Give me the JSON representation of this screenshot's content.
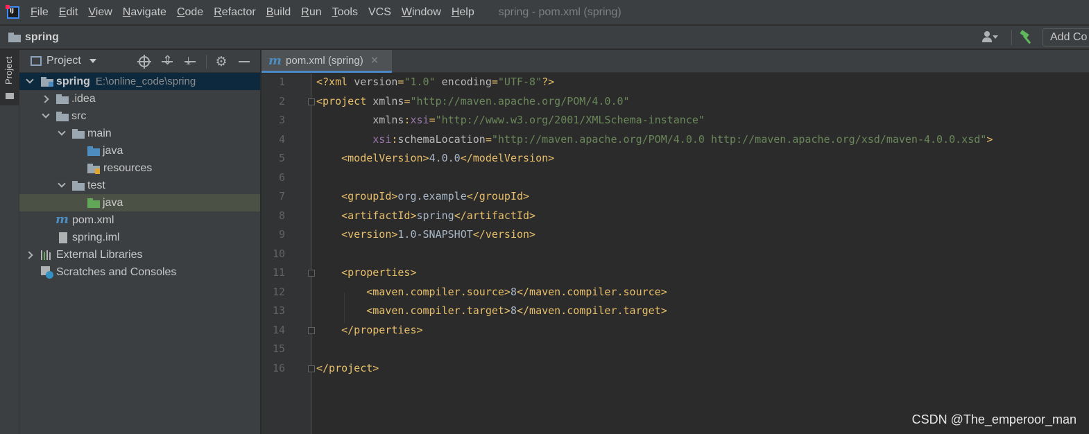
{
  "menubar": {
    "items": [
      {
        "u": "F",
        "rest": "ile"
      },
      {
        "u": "E",
        "rest": "dit"
      },
      {
        "u": "V",
        "rest": "iew"
      },
      {
        "u": "N",
        "rest": "avigate"
      },
      {
        "u": "C",
        "rest": "ode"
      },
      {
        "u": "R",
        "rest": "efactor"
      },
      {
        "u": "B",
        "rest": "uild"
      },
      {
        "u": "R",
        "rest": "un"
      },
      {
        "u": "T",
        "rest": "ools"
      },
      {
        "u": "VCS",
        "rest": ""
      },
      {
        "u": "W",
        "rest": "indow"
      },
      {
        "u": "H",
        "rest": "elp"
      }
    ],
    "window_title": "spring - pom.xml (spring)"
  },
  "navbar": {
    "project": "spring",
    "add_config": "Add Co"
  },
  "tool_strip": {
    "project_tab": "Project"
  },
  "project_panel": {
    "title": "Project",
    "tree": [
      {
        "label": "spring",
        "extra": "E:\\online_code\\spring"
      },
      {
        "label": ".idea"
      },
      {
        "label": "src"
      },
      {
        "label": "main"
      },
      {
        "label": "java"
      },
      {
        "label": "resources"
      },
      {
        "label": "test"
      },
      {
        "label": "java"
      },
      {
        "label": "pom.xml"
      },
      {
        "label": "spring.iml"
      },
      {
        "label": "External Libraries"
      },
      {
        "label": "Scratches and Consoles"
      }
    ]
  },
  "editor": {
    "tab_label": "pom.xml (spring)",
    "line_numbers": [
      "1",
      "2",
      "3",
      "4",
      "5",
      "6",
      "7",
      "8",
      "9",
      "10",
      "11",
      "12",
      "13",
      "14",
      "15",
      "16"
    ],
    "lines": [
      [
        [
          "tag",
          "<?xml "
        ],
        [
          "attr",
          "version"
        ],
        [
          "tag",
          "="
        ],
        [
          "str",
          "\"1.0\""
        ],
        [
          "tag",
          " "
        ],
        [
          "attr",
          "encoding"
        ],
        [
          "tag",
          "="
        ],
        [
          "str",
          "\"UTF-8\""
        ],
        [
          "tag",
          "?>"
        ]
      ],
      [
        [
          "tag",
          "<project "
        ],
        [
          "attr",
          "xmlns"
        ],
        [
          "tag",
          "="
        ],
        [
          "str",
          "\"http://maven.apache.org/POM/4.0.0\""
        ]
      ],
      [
        [
          "text",
          "         "
        ],
        [
          "attr",
          "xmlns"
        ],
        [
          "tag",
          ":"
        ],
        [
          "ns",
          "xsi"
        ],
        [
          "tag",
          "="
        ],
        [
          "str",
          "\"http://www.w3.org/2001/XMLSchema-instance\""
        ]
      ],
      [
        [
          "text",
          "         "
        ],
        [
          "ns",
          "xsi"
        ],
        [
          "tag",
          ":"
        ],
        [
          "attr",
          "schemaLocation"
        ],
        [
          "tag",
          "="
        ],
        [
          "str",
          "\"http://maven.apache.org/POM/4.0.0 http://maven.apache.org/xsd/maven-4.0.0.xsd\""
        ],
        [
          "tag",
          ">"
        ]
      ],
      [
        [
          "text",
          "    "
        ],
        [
          "tag",
          "<modelVersion>"
        ],
        [
          "text",
          "4.0.0"
        ],
        [
          "tag",
          "</modelVersion>"
        ]
      ],
      [],
      [
        [
          "text",
          "    "
        ],
        [
          "tag",
          "<groupId>"
        ],
        [
          "text",
          "org.example"
        ],
        [
          "tag",
          "</groupId>"
        ]
      ],
      [
        [
          "text",
          "    "
        ],
        [
          "tag",
          "<artifactId>"
        ],
        [
          "text",
          "spring"
        ],
        [
          "tag",
          "</artifactId>"
        ]
      ],
      [
        [
          "text",
          "    "
        ],
        [
          "tag",
          "<version>"
        ],
        [
          "text",
          "1.0-SNAPSHOT"
        ],
        [
          "tag",
          "</version>"
        ]
      ],
      [],
      [
        [
          "text",
          "    "
        ],
        [
          "tag",
          "<properties>"
        ]
      ],
      [
        [
          "text",
          "        "
        ],
        [
          "tag",
          "<maven.compiler.source>"
        ],
        [
          "text",
          "8"
        ],
        [
          "tag",
          "</maven.compiler.source>"
        ]
      ],
      [
        [
          "text",
          "        "
        ],
        [
          "tag",
          "<maven.compiler.target>"
        ],
        [
          "text",
          "8"
        ],
        [
          "tag",
          "</maven.compiler.target>"
        ]
      ],
      [
        [
          "text",
          "    "
        ],
        [
          "tag",
          "</properties>"
        ]
      ],
      [],
      [
        [
          "tag",
          "</project>"
        ]
      ]
    ]
  },
  "watermark": "CSDN @The_emperoor_man"
}
